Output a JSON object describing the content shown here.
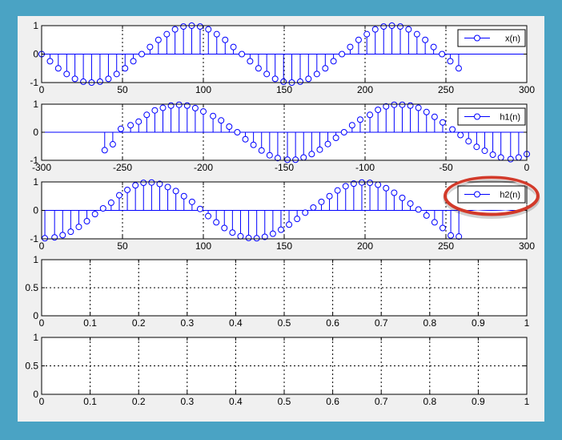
{
  "colors": {
    "stem": "#0000ff",
    "highlight": "#d23a2a",
    "axis": "#000000",
    "background": "#4aa3c4",
    "figure": "#f0f0f0"
  },
  "chart_data": [
    {
      "type": "stem",
      "legend": "x(n)",
      "legend_position": "top-right",
      "xlim": [
        0,
        300
      ],
      "ylim": [
        -1,
        1
      ],
      "xticks": [
        0,
        50,
        100,
        150,
        200,
        250,
        300
      ],
      "yticks": [
        -1,
        0,
        1
      ],
      "grid": true,
      "x": [
        0,
        5.2,
        10.3,
        15.5,
        20.6,
        25.8,
        30.9,
        36.1,
        41.3,
        46.4,
        51.6,
        56.7,
        61.9,
        67.0,
        72.2,
        77.4,
        82.5,
        87.7,
        92.8,
        98.0,
        103.1,
        108.3,
        113.5,
        118.6,
        123.8,
        128.9,
        134.1,
        139.2,
        144.4,
        149.6,
        154.7,
        159.9,
        165.0,
        170.2,
        175.4,
        180.5,
        185.7,
        190.8,
        196.0,
        201.1,
        206.3,
        211.5,
        216.6,
        221.8,
        226.9,
        232.1,
        237.2,
        242.4,
        247.6,
        252.7,
        257.9
      ],
      "y": [
        0.0,
        -0.25,
        -0.5,
        -0.7,
        -0.87,
        -0.97,
        -1.0,
        -0.97,
        -0.87,
        -0.7,
        -0.5,
        -0.25,
        0.0,
        0.25,
        0.5,
        0.7,
        0.87,
        0.97,
        1.0,
        0.97,
        0.87,
        0.7,
        0.5,
        0.25,
        0.0,
        -0.25,
        -0.5,
        -0.7,
        -0.87,
        -0.97,
        -1.0,
        -0.97,
        -0.87,
        -0.7,
        -0.5,
        -0.25,
        0.0,
        0.25,
        0.5,
        0.7,
        0.87,
        0.97,
        1.0,
        0.97,
        0.87,
        0.7,
        0.5,
        0.25,
        0.0,
        -0.25,
        -0.5
      ],
      "highlighted": false
    },
    {
      "type": "stem",
      "legend": "h1(n)",
      "legend_position": "top-right",
      "xlim": [
        -300,
        0
      ],
      "ylim": [
        -1,
        1
      ],
      "xticks": [
        -300,
        -250,
        -200,
        -150,
        -100,
        -50,
        0
      ],
      "yticks": [
        -1,
        0,
        1
      ],
      "grid": true,
      "x": [
        -261,
        -256,
        -251,
        -245,
        -240,
        -235,
        -230,
        -225,
        -220,
        -215,
        -210,
        -205,
        -200,
        -194,
        -189,
        -184,
        -179,
        -174,
        -169,
        -164,
        -159,
        -154,
        -148,
        -143,
        -138,
        -133,
        -128,
        -123,
        -118,
        -113,
        -108,
        -103,
        -97,
        -92,
        -87,
        -82,
        -77,
        -72,
        -67,
        -62,
        -57,
        -52,
        -46,
        -41,
        -36,
        -31,
        -26,
        -21,
        -16,
        -10,
        -5,
        0
      ],
      "y": [
        -0.64,
        -0.43,
        0.12,
        0.25,
        0.38,
        0.62,
        0.78,
        0.87,
        0.95,
        0.98,
        0.95,
        0.86,
        0.74,
        0.58,
        0.42,
        0.2,
        0.0,
        -0.25,
        -0.45,
        -0.65,
        -0.82,
        -0.92,
        -0.98,
        -0.98,
        -0.9,
        -0.78,
        -0.62,
        -0.42,
        -0.2,
        0.0,
        0.25,
        0.45,
        0.62,
        0.8,
        0.92,
        0.98,
        0.98,
        0.95,
        0.87,
        0.72,
        0.55,
        0.35,
        0.1,
        -0.1,
        -0.32,
        -0.52,
        -0.66,
        -0.8,
        -0.9,
        -0.96,
        -0.9,
        -0.78
      ],
      "highlighted": false
    },
    {
      "type": "stem",
      "legend": "h2(n)",
      "legend_position": "top-right",
      "xlim": [
        0,
        300
      ],
      "ylim": [
        -1,
        1
      ],
      "xticks": [
        0,
        50,
        100,
        150,
        200,
        250,
        300
      ],
      "yticks": [
        -1,
        0,
        1
      ],
      "grid": true,
      "x": [
        2,
        8,
        13,
        18,
        23,
        28,
        33,
        38,
        43,
        48,
        53,
        58,
        63,
        68,
        73,
        78,
        83,
        88,
        93,
        98,
        103,
        108,
        113,
        118,
        123,
        128,
        133,
        138,
        143,
        148,
        153,
        158,
        163,
        168,
        173,
        178,
        183,
        188,
        193,
        198,
        203,
        208,
        213,
        218,
        223,
        228,
        233,
        238,
        243,
        248,
        253,
        258
      ],
      "y": [
        -0.98,
        -0.95,
        -0.87,
        -0.75,
        -0.58,
        -0.38,
        -0.13,
        0.07,
        0.27,
        0.53,
        0.72,
        0.88,
        0.97,
        0.98,
        0.93,
        0.82,
        0.68,
        0.5,
        0.3,
        0.05,
        -0.2,
        -0.42,
        -0.62,
        -0.78,
        -0.91,
        -0.97,
        -0.98,
        -0.93,
        -0.82,
        -0.68,
        -0.5,
        -0.3,
        -0.08,
        0.1,
        0.3,
        0.5,
        0.7,
        0.85,
        0.94,
        0.98,
        0.97,
        0.9,
        0.78,
        0.62,
        0.44,
        0.24,
        0.03,
        -0.18,
        -0.42,
        -0.62,
        -0.88,
        -0.92
      ],
      "highlighted": true
    },
    {
      "type": "empty",
      "xlim": [
        0,
        1
      ],
      "ylim": [
        0,
        1
      ],
      "xticks": [
        0,
        0.1,
        0.2,
        0.3,
        0.4,
        0.5,
        0.6,
        0.7,
        0.8,
        0.9,
        1
      ],
      "yticks": [
        0,
        0.5,
        1
      ],
      "grid": true
    },
    {
      "type": "empty",
      "xlim": [
        0,
        1
      ],
      "ylim": [
        0,
        1
      ],
      "xticks": [
        0,
        0.1,
        0.2,
        0.3,
        0.4,
        0.5,
        0.6,
        0.7,
        0.8,
        0.9,
        1
      ],
      "yticks": [
        0,
        0.5,
        1
      ],
      "grid": true
    }
  ]
}
